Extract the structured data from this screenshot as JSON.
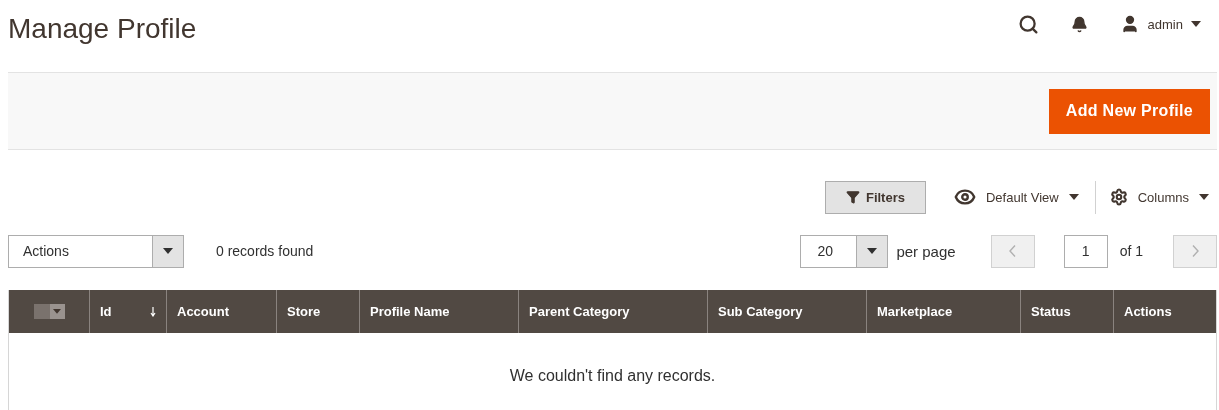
{
  "page_title": "Manage Profile",
  "header": {
    "user": "admin"
  },
  "actions_bar": {
    "add_button": "Add New Profile"
  },
  "toolbar": {
    "filters": "Filters",
    "view": "Default View",
    "columns": "Columns"
  },
  "mass_actions": {
    "label": "Actions"
  },
  "mass_select": {
    "checked": false
  },
  "records_found": "0 records found",
  "pager": {
    "per_page_value": "20",
    "per_page_label": "per page",
    "prev_disabled": true,
    "page": "1",
    "page_total": "of 1",
    "next_disabled": true
  },
  "table": {
    "columns": [
      {
        "label": "Id",
        "sorted": true
      },
      {
        "label": "Account",
        "sorted": false
      },
      {
        "label": "Store",
        "sorted": false
      },
      {
        "label": "Profile Name",
        "sorted": false
      },
      {
        "label": "Parent Category",
        "sorted": false
      },
      {
        "label": "Sub Category",
        "sorted": false
      },
      {
        "label": "Marketplace",
        "sorted": false
      },
      {
        "label": "Status",
        "sorted": false
      },
      {
        "label": "Actions",
        "sorted": false
      }
    ],
    "empty_message": "We couldn't find any records."
  }
}
